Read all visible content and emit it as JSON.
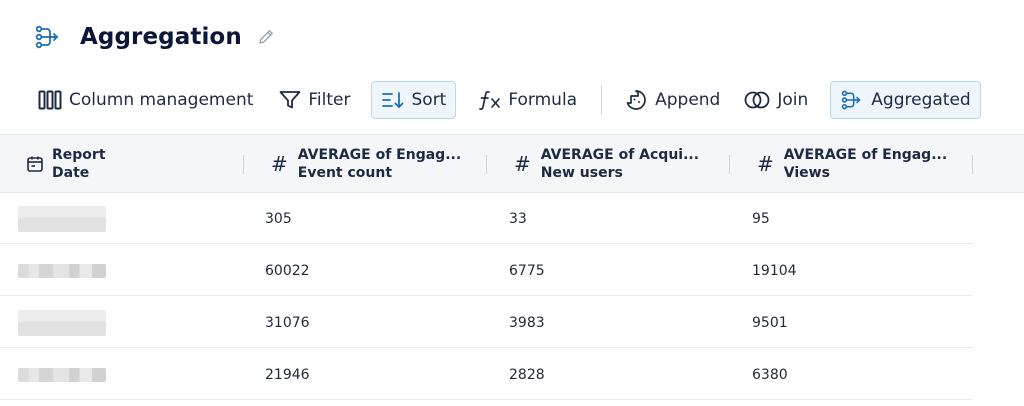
{
  "header": {
    "title": "Aggregation",
    "title_icon": "aggregation-icon",
    "edit_icon": "pencil-icon"
  },
  "toolbar": {
    "items": [
      {
        "label": "Column management",
        "icon": "columns-icon",
        "active": false
      },
      {
        "label": "Filter",
        "icon": "filter-icon",
        "active": false
      },
      {
        "label": "Sort",
        "icon": "sort-icon",
        "active": true
      },
      {
        "label": "Formula",
        "icon": "formula-icon",
        "active": false
      },
      {
        "label": "Append",
        "icon": "append-icon",
        "active": false
      },
      {
        "label": "Join",
        "icon": "join-icon",
        "active": false
      },
      {
        "label": "Aggregated",
        "icon": "aggregation-icon",
        "active": true
      }
    ]
  },
  "table": {
    "columns": [
      {
        "line1": "Report",
        "line2": "Date",
        "icon": "calendar-icon"
      },
      {
        "line1": "AVERAGE of Engag...",
        "line2": "Event count",
        "icon": "#"
      },
      {
        "line1": "AVERAGE of Acqui...",
        "line2": "New users",
        "icon": "#"
      },
      {
        "line1": "AVERAGE of Engag...",
        "line2": "Views",
        "icon": "#"
      }
    ],
    "rows": [
      [
        "",
        "305",
        "33",
        "95"
      ],
      [
        "",
        "60022",
        "6775",
        "19104"
      ],
      [
        "",
        "31076",
        "3983",
        "9501"
      ],
      [
        "",
        "21946",
        "2828",
        "6380"
      ]
    ]
  },
  "colors": {
    "title": "#0b1638",
    "text": "#1e2a44",
    "active_bg": "#eef6fb",
    "active_border": "#b9d9ea",
    "accent": "#1e6fb8",
    "header_bg": "#f4f6f8"
  }
}
